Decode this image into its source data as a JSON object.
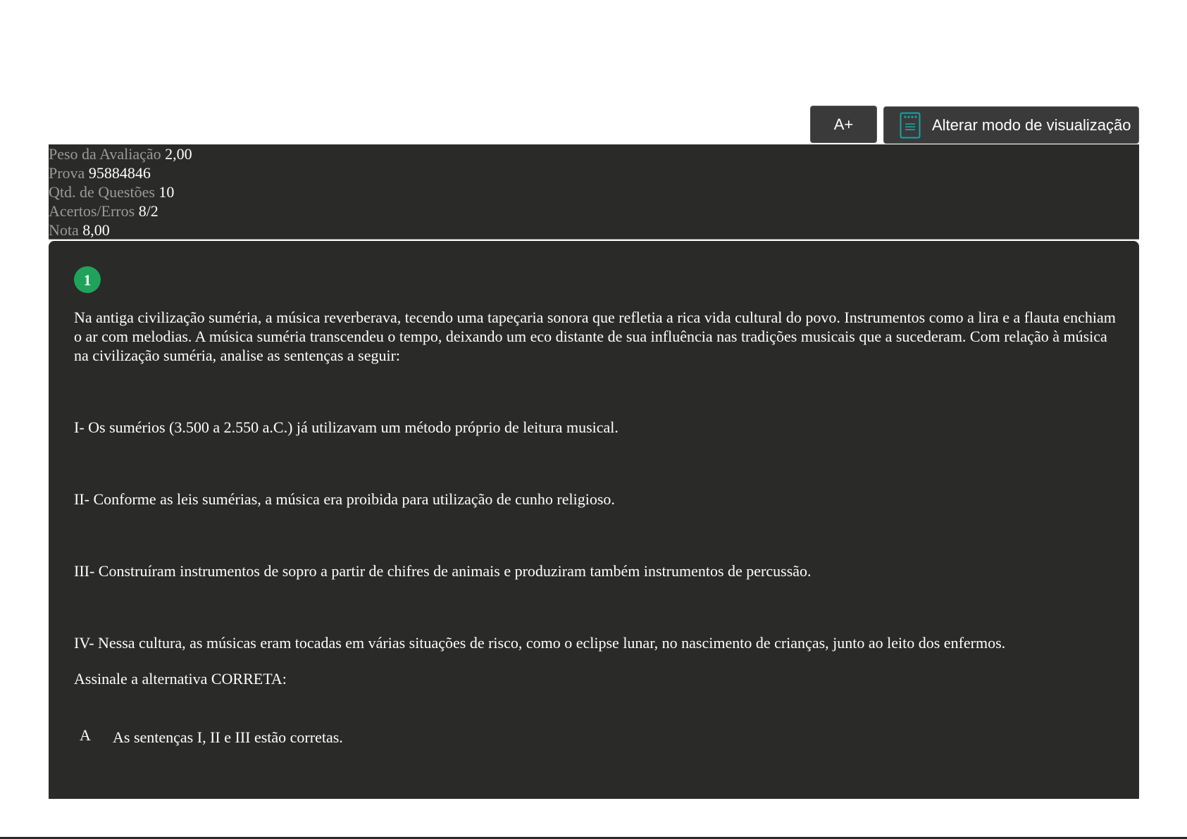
{
  "toolbar": {
    "font_increase_label": "A+",
    "view_mode_label": "Alterar modo de visualização",
    "view_mode_icon": "document-icon",
    "icon_color": "#1aa3a3"
  },
  "summary": {
    "weight_label": "Peso da Avaliação",
    "weight_value": "2,00",
    "exam_label": "Prova",
    "exam_value": "95884846",
    "questions_label": "Qtd. de Questões",
    "questions_value": "10",
    "score_label": "Acertos/Erros",
    "score_value": "8/2",
    "grade_label": "Nota",
    "grade_value": "8,00"
  },
  "question": {
    "number": "1",
    "number_color": "#1fa35b",
    "intro": "Na antiga civilização suméria, a música reverberava, tecendo uma tapeçaria sonora que refletia a rica vida cultural do povo. Instrumentos como a lira e a flauta enchiam o ar com melodias. A música suméria transcendeu o tempo, deixando um eco distante de sua influência nas tradições musicais que a sucederam. Com relação à música na civilização suméria, analise as sentenças a seguir:",
    "statements": [
      "I- Os sumérios (3.500 a 2.550 a.C.) já utilizavam um método próprio de leitura musical.",
      "II- Conforme as leis sumérias, a música era proibida para utilização de cunho religioso.",
      "III- Construíram instrumentos de sopro a partir de chifres de animais e produziram também instrumentos de percussão.",
      "IV- Nessa cultura, as músicas eram tocadas em várias situações de risco, como o eclipse lunar, no nascimento de crianças, junto ao leito dos enfermos."
    ],
    "prompt": "Assinale a alternativa CORRETA:",
    "alternatives": [
      {
        "letter": "A",
        "text": "As sentenças I, II e III estão corretas."
      }
    ]
  }
}
